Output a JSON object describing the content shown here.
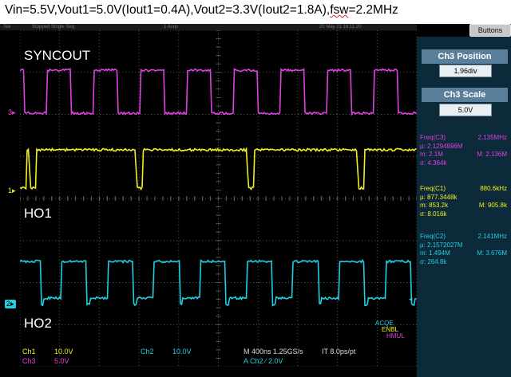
{
  "caption": {
    "main": "Vin=5.5V,Vout1=5.0V(Iout1=0.4A),Vout2=3.3V(Iout2=1.8A),",
    "fsw_prefix": "fsw",
    "fsw_rest": "=2.2MHz"
  },
  "topbar": {
    "brand": "Tek",
    "status": "Stopped Single Seq",
    "acqs": "1 Acqs",
    "datetime": "20 May 21 16:11:20"
  },
  "buttons_label": "Buttons",
  "panels": {
    "position_title": "Ch3 Position",
    "position_value": "1.96div",
    "scale_title": "Ch3 Scale",
    "scale_value": "5.0V"
  },
  "measurements": {
    "c3": {
      "header": "Freq(C3)",
      "header_value": "2.135MHz",
      "mean": "µ: 2.1294896M",
      "min": "m: 2.1M",
      "max": "M: 2.136M",
      "sigma": "σ: 4.364k",
      "color": "#e040e0"
    },
    "c1": {
      "header": "Freq(C1)",
      "header_value": "880.6kHz",
      "mean": "µ: 877.3448k",
      "min": "m: 853.2k",
      "max": "M: 905.8k",
      "sigma": "σ: 8.016k",
      "color": "#f0f020"
    },
    "c2": {
      "header": "Freq(C2)",
      "header_value": "2.141MHz",
      "mean": "µ: 2.1572027M",
      "min": "m: 1.494M",
      "max": "M: 3.676M",
      "sigma": "σ: 264.8k",
      "color": "#20d0e0"
    }
  },
  "waveform_labels": {
    "syncout": "SYNCOUT",
    "ho1": "HO1",
    "ho2": "HO2"
  },
  "channel_markers": {
    "ch3": "3",
    "ch1": "1",
    "ch2": "2"
  },
  "overlay_text": {
    "line1": "ACQE",
    "line2": "ENBL",
    "line3": "HMUL"
  },
  "bottom": {
    "ch1_label": "Ch1",
    "ch1_value": "10.0V",
    "ch2_label": "Ch2",
    "ch2_value": "10.0V",
    "ch3_label": "Ch3",
    "ch3_value": "5.0V",
    "timebase": "M 400ns 1.25GS/s",
    "record": "IT 8.0ps/pt",
    "trigger": "A Ch2 ⁄ 2.0V"
  },
  "colors": {
    "ch1": "#f0f020",
    "ch2": "#20d0e0",
    "ch3": "#e040e0",
    "grid": "#5a5a5a"
  }
}
